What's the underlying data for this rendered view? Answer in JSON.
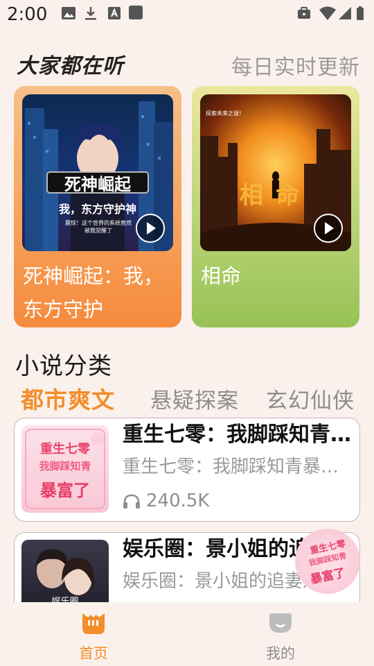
{
  "status_bar": {
    "time": "2:00"
  },
  "hot_section": {
    "title": "大家都在听",
    "subtitle": "每日实时更新",
    "cards": [
      {
        "title": "死神崛起：我，东方守护",
        "cover_text": "死神崛起",
        "cover_sub": "我，东方守护神",
        "cover_note": "震惊！这个世界的系统竟然 被我觉醒了"
      },
      {
        "title": "相命",
        "cover_text": "相命",
        "cover_note": "探索未来之谜！"
      }
    ]
  },
  "category_section": {
    "title": "小说分类",
    "tabs": [
      "都市爽文",
      "悬疑探案",
      "玄幻仙侠"
    ],
    "active_tab": 0
  },
  "list": [
    {
      "title": "重生七零：我脚踩知青暴富了",
      "desc": "重生七零：我脚踩知青暴富了",
      "plays": "240.5K",
      "thumb_text": [
        "重生七零",
        "我脚踩知青",
        "暴富了"
      ]
    },
    {
      "title": "娱乐圈：景小姐的追妻之路",
      "desc": "娱乐圈：景小姐的追妻之路",
      "plays": "",
      "thumb_text": [
        "娱乐圈"
      ]
    }
  ],
  "bottom_nav": [
    {
      "label": "首页",
      "active": true
    },
    {
      "label": "我的",
      "active": false
    }
  ],
  "colors": {
    "accent": "#f48d2a",
    "background": "#fbf1ec",
    "card1": "#f58a3c",
    "card2": "#97c256"
  }
}
